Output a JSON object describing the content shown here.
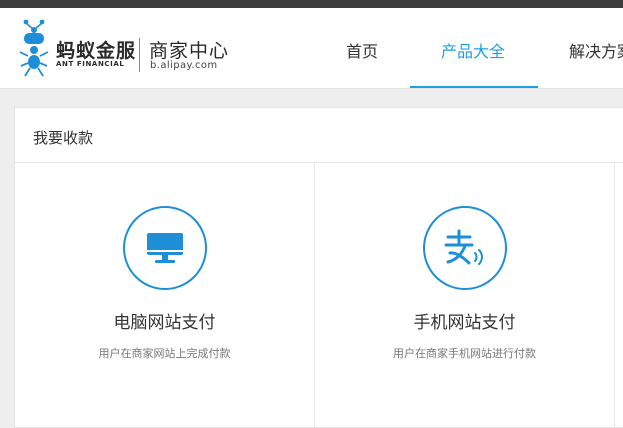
{
  "header": {
    "brand_cn": "蚂蚁金服",
    "brand_en": "ANT FINANCIAL",
    "center_cn": "商家中心",
    "center_url": "b.alipay.com",
    "nav": [
      {
        "label": "首页",
        "active": false
      },
      {
        "label": "产品大全",
        "active": true
      },
      {
        "label": "解决方案",
        "active": false
      }
    ]
  },
  "colors": {
    "accent": "#1ea0e0",
    "icon": "#1e8fd6",
    "topbar": "#3c3c3c"
  },
  "section": {
    "title": "我要收款",
    "cards": [
      {
        "icon": "monitor-icon",
        "title": "电脑网站支付",
        "desc": "用户在商家网站上完成付款"
      },
      {
        "icon": "alipay-mobile-icon",
        "title": "手机网站支付",
        "desc": "用户在商家手机网站进行付款"
      }
    ]
  }
}
